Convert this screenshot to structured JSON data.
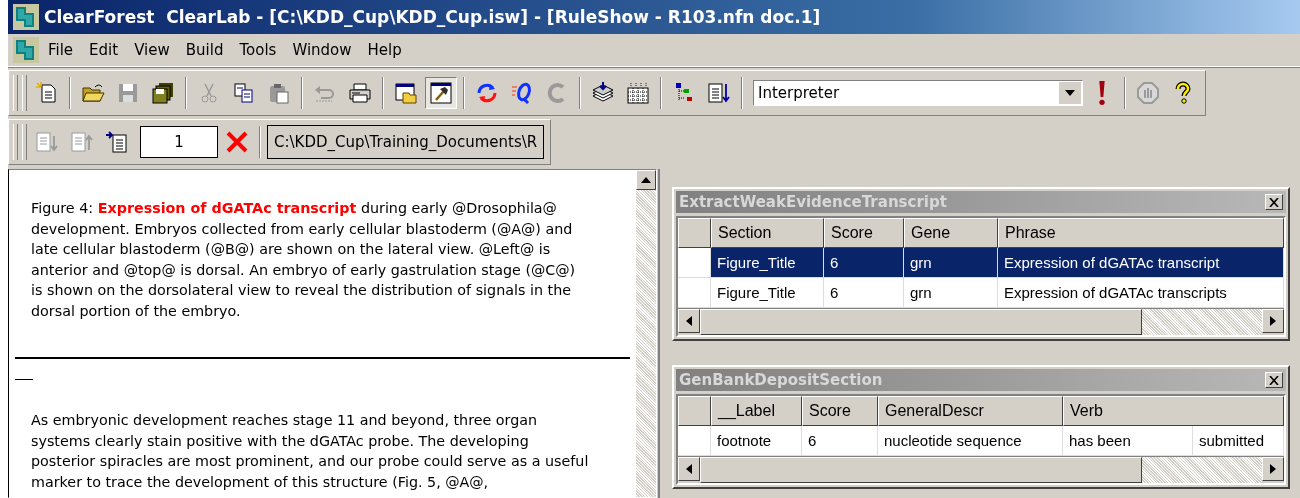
{
  "window": {
    "title": "ClearForest  ClearLab - [C:\\KDD_Cup\\KDD_Cup.isw] - [RuleShow - R103.nfn doc.1]"
  },
  "menu": [
    "File",
    "Edit",
    "View",
    "Build",
    "Tools",
    "Window",
    "Help"
  ],
  "toolbar": {
    "items": [
      {
        "kind": "new",
        "disabled": false
      },
      {
        "kind": "separator"
      },
      {
        "kind": "open",
        "disabled": false
      },
      {
        "kind": "save",
        "disabled": true
      },
      {
        "kind": "save-all",
        "disabled": false
      },
      {
        "kind": "separator"
      },
      {
        "kind": "cut",
        "disabled": true
      },
      {
        "kind": "copy",
        "disabled": false
      },
      {
        "kind": "paste",
        "disabled": true
      },
      {
        "kind": "separator"
      },
      {
        "kind": "undo",
        "disabled": true
      },
      {
        "kind": "print",
        "disabled": false
      },
      {
        "kind": "separator"
      },
      {
        "kind": "window",
        "disabled": false,
        "pressed": false
      },
      {
        "kind": "build",
        "disabled": false,
        "pressed": true
      },
      {
        "kind": "separator"
      },
      {
        "kind": "refresh",
        "disabled": false
      },
      {
        "kind": "query",
        "disabled": false
      },
      {
        "kind": "c",
        "disabled": true
      },
      {
        "kind": "separator"
      },
      {
        "kind": "stack",
        "disabled": false
      },
      {
        "kind": "grid",
        "disabled": false
      },
      {
        "kind": "separator"
      },
      {
        "kind": "tree",
        "disabled": false
      },
      {
        "kind": "sort",
        "disabled": false
      },
      {
        "kind": "separator"
      },
      {
        "kind": "combo",
        "value": "Interpreter"
      },
      {
        "kind": "run",
        "disabled": false
      },
      {
        "kind": "separator"
      },
      {
        "kind": "stop",
        "disabled": true
      },
      {
        "kind": "help",
        "disabled": false
      }
    ]
  },
  "doc_toolbar": {
    "items": [
      {
        "kind": "next-doc",
        "disabled": true
      },
      {
        "kind": "prev-doc",
        "disabled": true
      },
      {
        "kind": "goto-doc",
        "disabled": false
      },
      {
        "kind": "number",
        "value": "1"
      },
      {
        "kind": "delete",
        "disabled": false
      },
      {
        "kind": "separator"
      },
      {
        "kind": "path",
        "value": "C:\\KDD_Cup\\Training_Documents\\R"
      }
    ]
  },
  "document": {
    "paragraphs": [
      "Figure 4: **Expression of dGATAc transcript** during early @Drosophila@ development. Embryos collected from early cellular blastoderm (@A@) and late cellular blastoderm (@B@) are shown on the lateral view. @Left@ is anterior and @top@ is dorsal. An embryo of early gastrulation stage (@C@) is shown on the dorsolateral view to reveal the distribution of signals in the dorsal portion of the embryo.",
      "As embryonic development reaches stage 11 and beyond, three organ systems clearly stain positive with the dGATAc probe. The developing posterior spiracles are most prominent, and our probe could serve as a useful marker to trace the development of this structure (Fig. 5, @A@,"
    ]
  },
  "panels": [
    {
      "title": "ExtractWeakEvidenceTranscript",
      "columns": [
        "Section",
        "Score",
        "Gene",
        "Phrase"
      ],
      "rows": [
        {
          "cells": [
            "Figure_Title",
            "6",
            "grn",
            "Expression of dGATAc transcript"
          ],
          "selected": true
        },
        {
          "cells": [
            "Figure_Title",
            "6",
            "grn",
            "Expression of dGATAc transcripts"
          ],
          "selected": false
        }
      ]
    },
    {
      "title": "GenBankDepositSection",
      "columns": [
        "__Label",
        "Score",
        "GeneralDescr",
        "Verb"
      ],
      "rows": [
        {
          "cells": [
            "footnote",
            "6",
            "nucleotide sequence",
            "has been",
            "submitted"
          ],
          "selected": false
        }
      ]
    }
  ]
}
